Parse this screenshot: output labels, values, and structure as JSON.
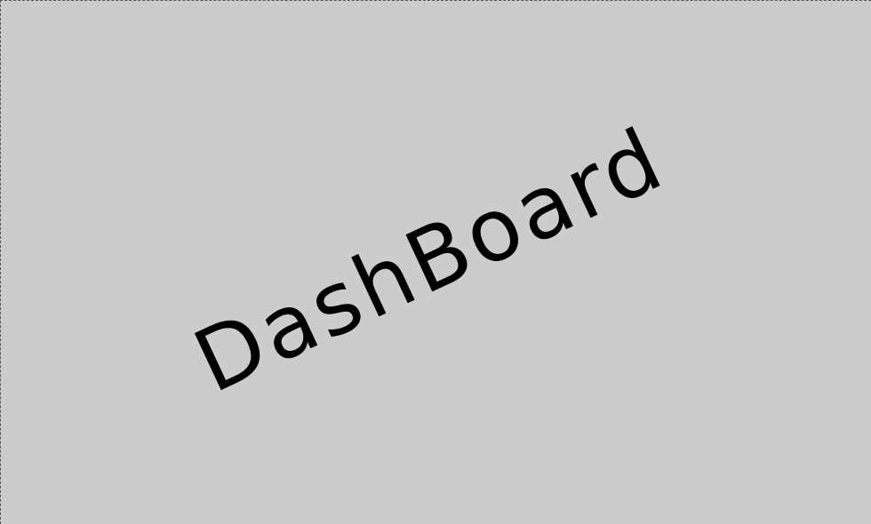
{
  "placeholder": {
    "label": "DashBoard"
  },
  "colors": {
    "background": "#cccccc",
    "border": "#555555",
    "text": "#000000"
  }
}
